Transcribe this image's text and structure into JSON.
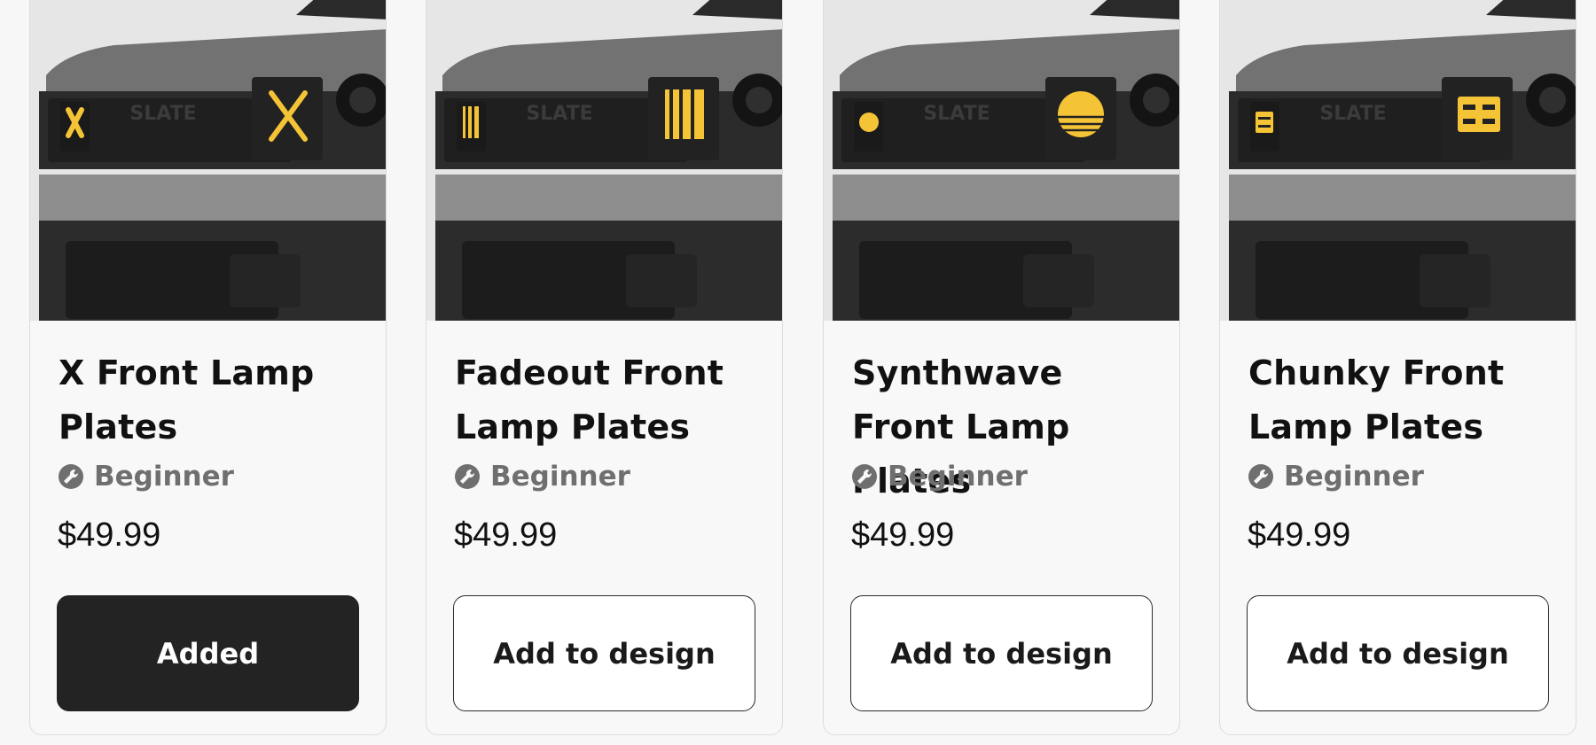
{
  "products": [
    {
      "title": "X Front Lamp Plates",
      "level": "Beginner",
      "price": "$49.99",
      "button": "Added",
      "selected": true,
      "lamp_pattern": "x",
      "brand_text": "SLATE"
    },
    {
      "title": "Fadeout Front Lamp Plates",
      "level": "Beginner",
      "price": "$49.99",
      "button": "Add to design",
      "selected": false,
      "lamp_pattern": "fadeout",
      "brand_text": "SLATE"
    },
    {
      "title": "Synthwave Front Lamp Plates",
      "level": "Beginner",
      "price": "$49.99",
      "button": "Add to design",
      "selected": false,
      "lamp_pattern": "synthwave",
      "brand_text": "SLATE"
    },
    {
      "title": "Chunky Front Lamp Plates",
      "level": "Beginner",
      "price": "$49.99",
      "button": "Add to design",
      "selected": false,
      "lamp_pattern": "chunky",
      "brand_text": "SLATE"
    }
  ],
  "colors": {
    "accent_yellow": "#f5c436",
    "button_dark": "#232323",
    "muted_text": "#6f6f6f"
  },
  "icons": {
    "level": "wrench-icon"
  }
}
